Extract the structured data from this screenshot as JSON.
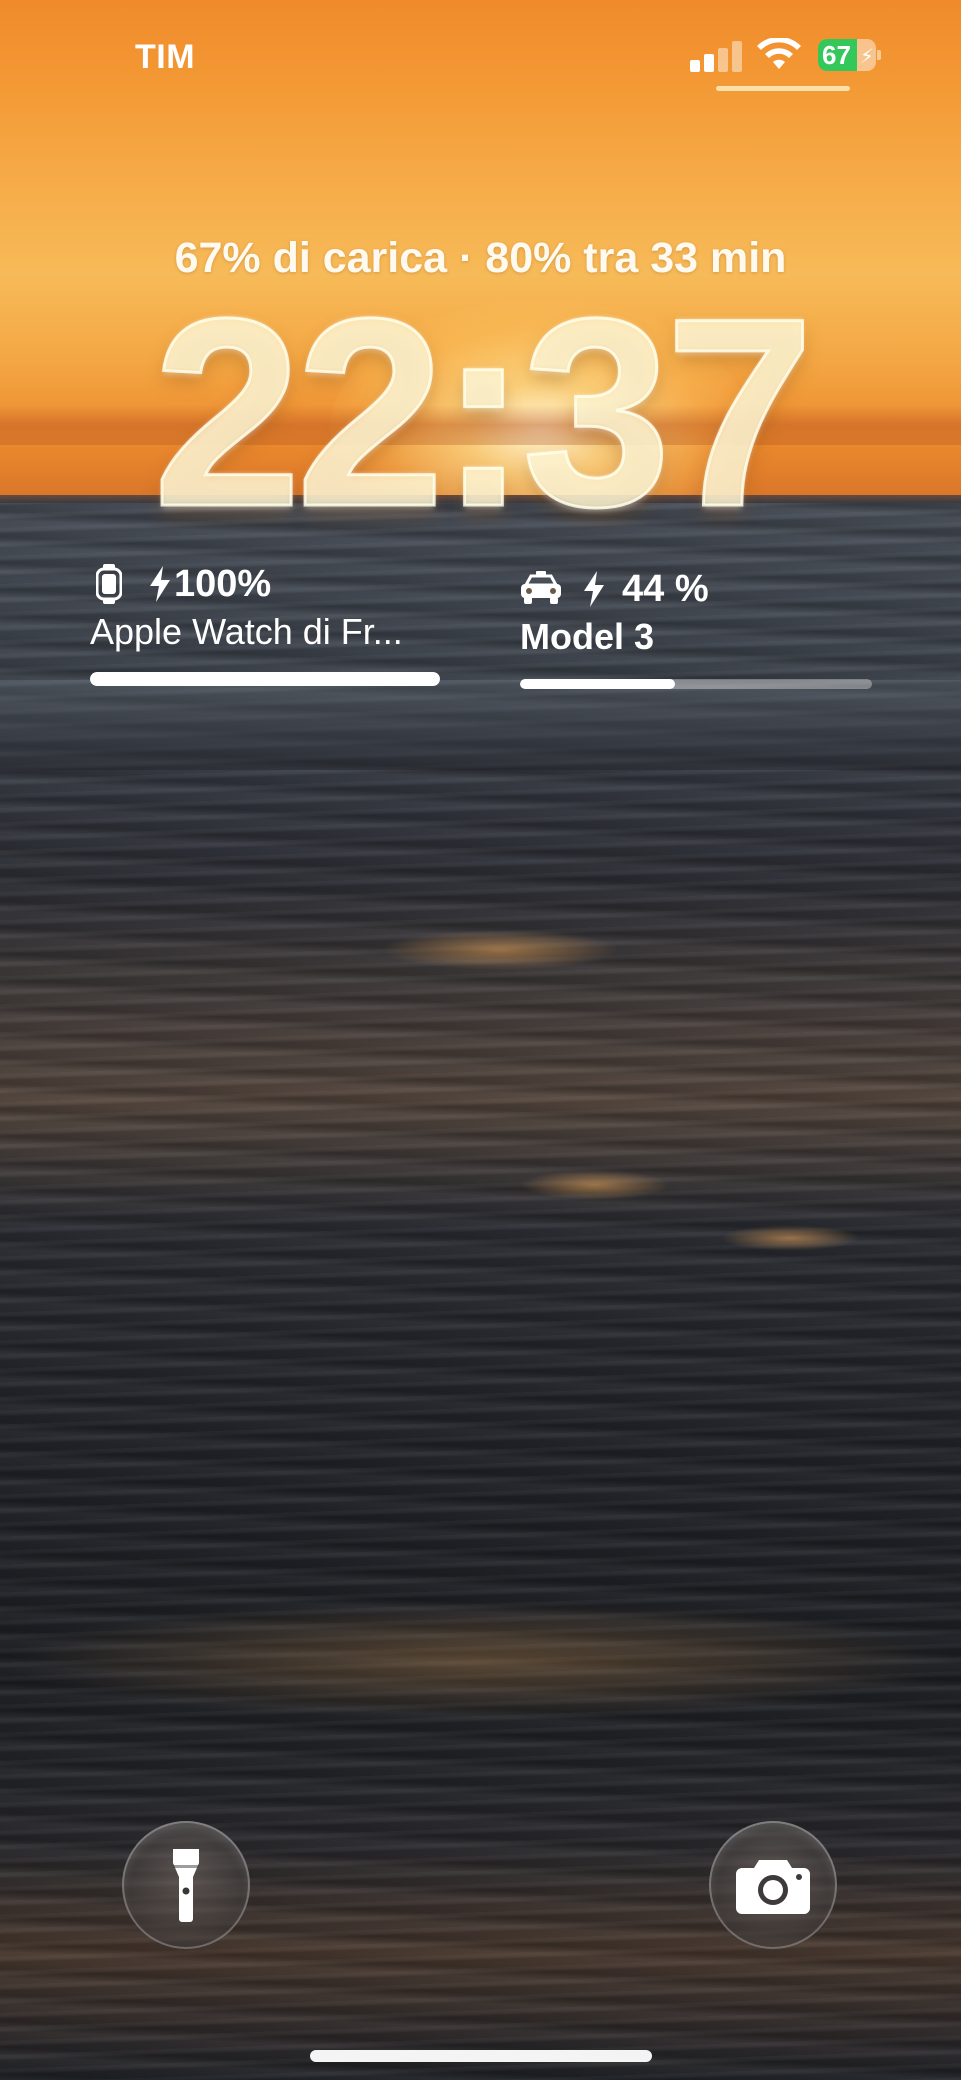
{
  "status_bar": {
    "carrier": "TIM",
    "signal_icon": "cellular-signal-icon",
    "signal_bars_active": 2,
    "signal_bars_total": 4,
    "wifi_icon": "wifi-icon",
    "battery_level": "67",
    "battery_fraction": 0.67,
    "battery_charging": true,
    "battery_color": "#34c759"
  },
  "lock_screen": {
    "charge_status": "67% di carica · 80% tra 33 min",
    "time": "22:37"
  },
  "widgets": [
    {
      "icon": "watch-icon",
      "charging_icon": "bolt-icon",
      "percent": "100%",
      "name": "Apple Watch di Fr...",
      "level": 1.0
    },
    {
      "icon": "car-icon",
      "charging_icon": "bolt-icon",
      "percent": "44 %",
      "name": "Model 3",
      "level": 0.44
    }
  ],
  "bottom_actions": {
    "left_icon": "flashlight-icon",
    "right_icon": "camera-icon"
  },
  "colors": {
    "sky_top": "#f08a2a",
    "sun": "#fff6c8",
    "sea": "#2a2c32"
  }
}
